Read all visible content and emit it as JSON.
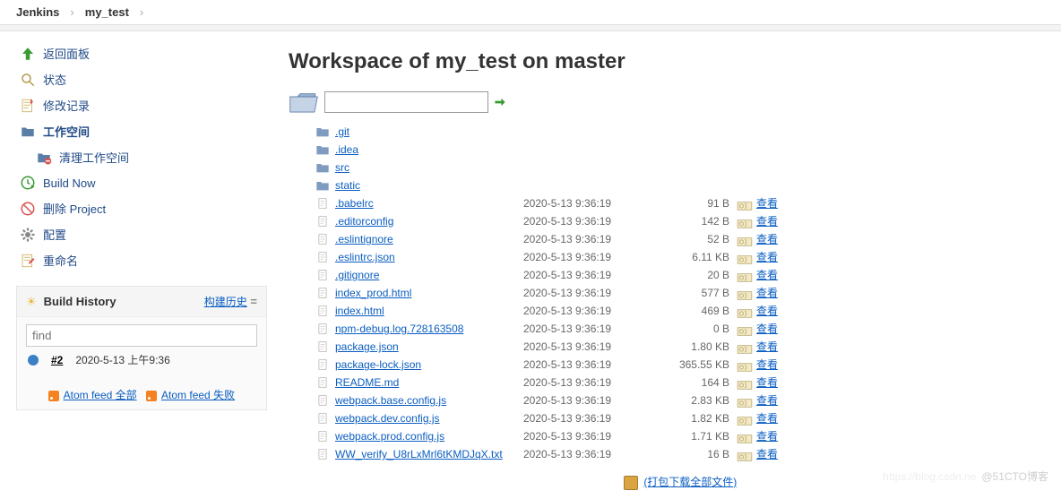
{
  "breadcrumbs": {
    "home": "Jenkins",
    "job": "my_test"
  },
  "sidebar": {
    "items": [
      {
        "label": "返回面板"
      },
      {
        "label": "状态"
      },
      {
        "label": "修改记录"
      },
      {
        "label": "工作空间"
      },
      {
        "label": "清理工作空间"
      },
      {
        "label": "Build Now"
      },
      {
        "label": "删除 Project"
      },
      {
        "label": "配置"
      },
      {
        "label": "重命名"
      }
    ]
  },
  "history": {
    "title": "Build History",
    "trend": "构建历史",
    "find_placeholder": "find",
    "build_id": "#2",
    "build_time": "2020-5-13 上午9:36",
    "atom_all": "Atom feed 全部",
    "atom_fail": "Atom feed 失败"
  },
  "page_title": "Workspace of my_test on master",
  "folders": [
    {
      "name": ".git"
    },
    {
      "name": ".idea"
    },
    {
      "name": "src"
    },
    {
      "name": "static"
    }
  ],
  "files": [
    {
      "name": ".babelrc",
      "date": "2020-5-13 9:36:19",
      "size": "91 B",
      "view": "查看"
    },
    {
      "name": ".editorconfig",
      "date": "2020-5-13 9:36:19",
      "size": "142 B",
      "view": "查看"
    },
    {
      "name": ".eslintignore",
      "date": "2020-5-13 9:36:19",
      "size": "52 B",
      "view": "查看"
    },
    {
      "name": ".eslintrc.json",
      "date": "2020-5-13 9:36:19",
      "size": "6.11 KB",
      "view": "查看"
    },
    {
      "name": ".gitignore",
      "date": "2020-5-13 9:36:19",
      "size": "20 B",
      "view": "查看"
    },
    {
      "name": "index_prod.html",
      "date": "2020-5-13 9:36:19",
      "size": "577 B",
      "view": "查看"
    },
    {
      "name": "index.html",
      "date": "2020-5-13 9:36:19",
      "size": "469 B",
      "view": "查看"
    },
    {
      "name": "npm-debug.log.728163508",
      "date": "2020-5-13 9:36:19",
      "size": "0 B",
      "view": "查看"
    },
    {
      "name": "package.json",
      "date": "2020-5-13 9:36:19",
      "size": "1.80 KB",
      "view": "查看"
    },
    {
      "name": "package-lock.json",
      "date": "2020-5-13 9:36:19",
      "size": "365.55 KB",
      "view": "查看"
    },
    {
      "name": "README.md",
      "date": "2020-5-13 9:36:19",
      "size": "164 B",
      "view": "查看"
    },
    {
      "name": "webpack.base.config.js",
      "date": "2020-5-13 9:36:19",
      "size": "2.83 KB",
      "view": "查看"
    },
    {
      "name": "webpack.dev.config.js",
      "date": "2020-5-13 9:36:19",
      "size": "1.82 KB",
      "view": "查看"
    },
    {
      "name": "webpack.prod.config.js",
      "date": "2020-5-13 9:36:19",
      "size": "1.71 KB",
      "view": "查看"
    },
    {
      "name": "WW_verify_U8rLxMrl6tKMDJqX.txt",
      "date": "2020-5-13 9:36:19",
      "size": "16 B",
      "view": "查看"
    }
  ],
  "download_all": "(打包下载全部文件)",
  "watermark": {
    "faint": "https://blog.csdn.ne",
    "main": "@51CTO博客"
  }
}
